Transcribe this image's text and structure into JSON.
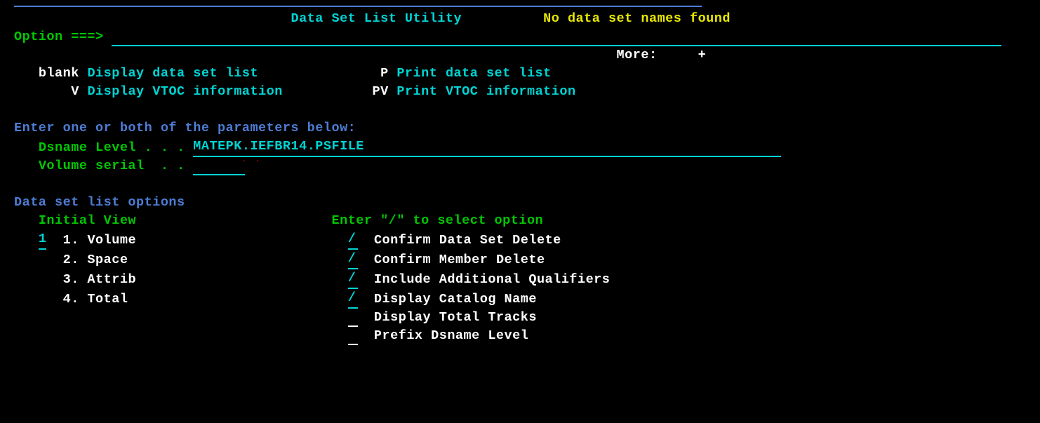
{
  "header": {
    "title": "Data Set List Utility",
    "message": "No data set names found",
    "option_label": "Option ===>",
    "more_label": "More:",
    "more_indicator": "+"
  },
  "commands": {
    "blank": {
      "code": "blank",
      "desc": "Display data set list"
    },
    "v": {
      "code": "V",
      "desc": "Display VTOC information"
    },
    "p": {
      "code": "P",
      "desc": "Print data set list"
    },
    "pv": {
      "code": "PV",
      "desc": "Print VTOC information"
    }
  },
  "params": {
    "prompt": "Enter one or both of the parameters below:",
    "dsname_label": "Dsname Level . . .",
    "dsname_value": "MATEPK.IEFBR14.PSFILE",
    "volser_label": "Volume serial  . ."
  },
  "options": {
    "section": "Data set list options",
    "initial_view_label": "Initial View",
    "initial_view_value": "1",
    "iv1": "1. Volume",
    "iv2": "2. Space",
    "iv3": "3. Attrib",
    "iv4": "4. Total",
    "select_prompt": "Enter \"/\" to select option",
    "sel1": {
      "val": "/",
      "label": "Confirm Data Set Delete"
    },
    "sel2": {
      "val": "/",
      "label": "Confirm Member Delete"
    },
    "sel3": {
      "val": "/",
      "label": "Include Additional Qualifiers"
    },
    "sel4": {
      "val": "/",
      "label": "Display Catalog Name"
    },
    "sel5": {
      "val": "",
      "label": "Display Total Tracks"
    },
    "sel6": {
      "val": "",
      "label": "Prefix Dsname Level"
    }
  }
}
